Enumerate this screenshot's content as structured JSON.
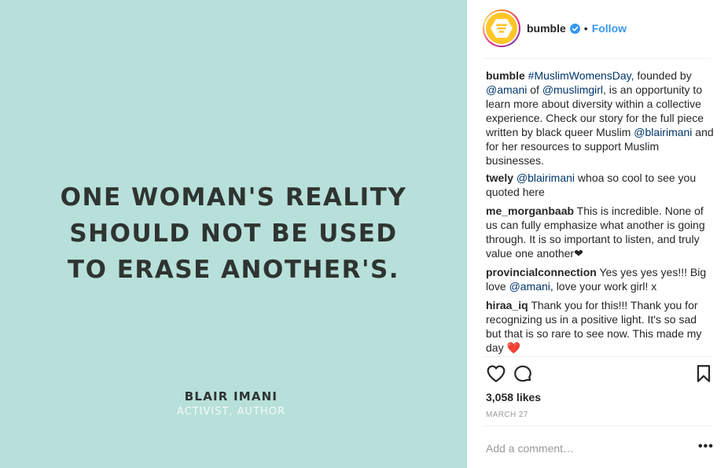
{
  "post_image": {
    "quote_lines": [
      "ONE WOMAN'S REALITY",
      "SHOULD NOT BE USED",
      "TO ERASE ANOTHER'S."
    ],
    "author": "BLAIR IMANI",
    "author_role": "ACTIVIST, AUTHOR",
    "background_color": "#b8e0da"
  },
  "header": {
    "username": "bumble",
    "separator": "•",
    "follow_label": "Follow"
  },
  "caption": {
    "username": "bumble",
    "hashtag": "#MuslimWomensDay",
    "text1": ", founded by ",
    "mention1": "@amani",
    "text2": " of ",
    "mention2": "@muslimgirl",
    "text3": ", is an opportunity to learn more about diversity within a collective experience. Check our story for the full piece written by black queer Muslim ",
    "mention3": "@blairimani",
    "text4": " and for her resources to support Muslim businesses."
  },
  "comments": [
    {
      "username": "twely",
      "mention": "@blairimani",
      "text": " whoa so cool to see you quoted here"
    },
    {
      "username": "me_morganbaab",
      "text": " This is incredible. None of us can fully emphasize what another is going through. It is so important to listen, and truly value one another",
      "emoji": "❤"
    },
    {
      "username": "provincialconnection",
      "text_before": " Yes yes yes yes!!! Big love ",
      "mention": "@amani",
      "text_after": ", love your work girl! x"
    },
    {
      "username": "hiraa_iq",
      "text": " Thank you for this!!! Thank you for recognizing us in a positive light. It's so sad but that is so rare to see now. This made my day ",
      "emoji": "❤️"
    }
  ],
  "stats": {
    "likes": "3,058 likes",
    "date": "MARCH 27"
  },
  "add_comment": {
    "placeholder": "Add a comment…"
  },
  "more_options": "•••",
  "colors": {
    "accent": "#3897f0",
    "link": "#003569",
    "brand_yellow": "#ffc629"
  }
}
